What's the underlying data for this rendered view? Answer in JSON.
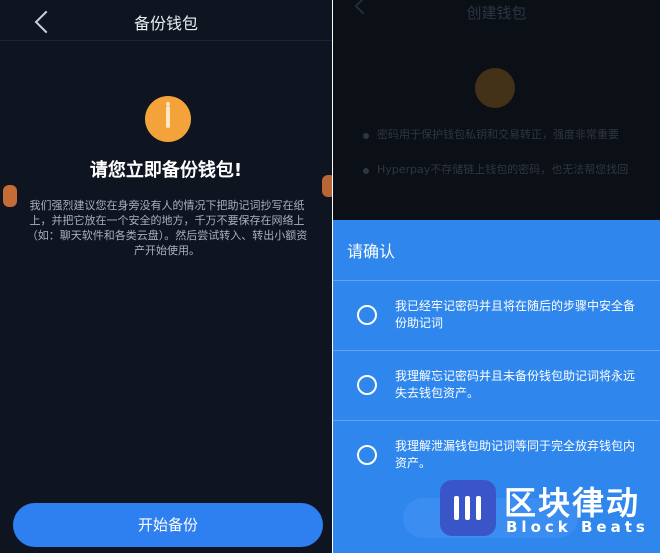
{
  "left_screen": {
    "header_title": "备份钱包",
    "heading": "请您立即备份钱包!",
    "description": "我们强烈建议您在身旁没有人的情况下把助记词抄写在纸上，并把它放在一个安全的地方，千万不要保存在网络上（如：聊天软件和各类云盘）。然后尝试转入、转出小额资产开始使用。",
    "start_button_label": "开始备份",
    "icon": "info-icon",
    "accent_color": "#f3a33a",
    "button_color": "#2e7ff0"
  },
  "right_screen": {
    "header_title": "创建钱包",
    "background_bullets": [
      "密码用于保护钱包私钥和交易转正，强度非常重要",
      "Hyperpay不存储链上钱包的密码，也无法帮您找回"
    ],
    "dialog": {
      "title": "请确认",
      "options": [
        "我已经牢记密码并且将在随后的步骤中安全备份助记词",
        "我理解忘记密码并且未备份钱包助记词将永远失去钱包资产。",
        "我理解泄漏钱包助记词等同于完全放弃钱包内资产。"
      ],
      "sheet_color": "#2f86ec"
    }
  },
  "watermark": {
    "zh": "区块律动",
    "en": "Block Beats"
  }
}
